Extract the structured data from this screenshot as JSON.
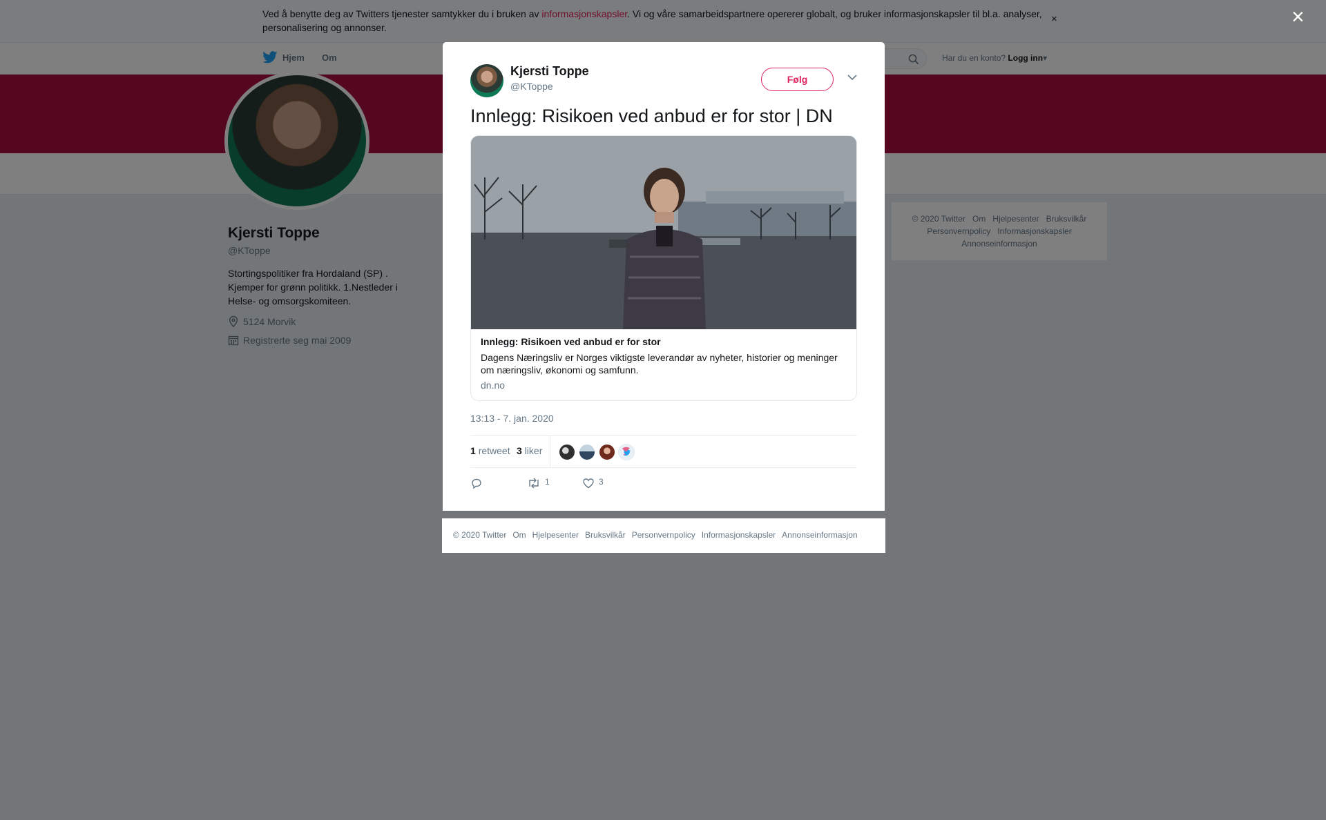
{
  "cookie": {
    "text_before": "Ved å benytte deg av Twitters tjenester samtykker du i bruken av ",
    "link": "informasjonskapsler",
    "text_after": ". Vi og våre samarbeidspartnere opererer globalt, og bruker informasjonskapsler til bl.a. analyser, personalisering og annonser.",
    "close": "×"
  },
  "nav": {
    "home": "Hjem",
    "about": "Om",
    "login_prompt": "Har du en konto?",
    "login": "Logg inn"
  },
  "profile": {
    "name": "Kjersti Toppe",
    "handle": "@KToppe",
    "bio": "Stortingspolitiker fra Hordaland (SP) . Kjemper for grønn politikk. 1.Nestleder i Helse- og omsorgskomiteen.",
    "location": "5124 Morvik",
    "joined": "Registrerte seg mai 2009"
  },
  "side_footer": [
    "© 2020 Twitter",
    "Om",
    "Hjelpesenter",
    "Bruksvilkår",
    "Personvernpolicy",
    "Informasjonskapsler",
    "Annonseinformasjon"
  ],
  "modal": {
    "close": "×",
    "name": "Kjersti Toppe",
    "handle": "@KToppe",
    "follow": "Følg",
    "tweet_text": "Innlegg: Risikoen ved anbud er for stor | DN",
    "card": {
      "title": "Innlegg: Risikoen ved anbud er for stor",
      "description": "Dagens Næringsliv er Norges viktigste leverandør av nyheter, historier og meninger om næringsliv, økonomi og samfunn.",
      "domain": "dn.no"
    },
    "timestamp": "13:13 - 7. jan. 2020",
    "retweets": "1",
    "retweets_label": "retweet",
    "likes": "3",
    "likes_label": "liker",
    "action_retweets": "1",
    "action_likes": "3"
  },
  "modal_footer": [
    "© 2020 Twitter",
    "Om",
    "Hjelpesenter",
    "Bruksvilkår",
    "Personvernpolicy",
    "Informasjonskapsler",
    "Annonseinformasjon"
  ],
  "colors": {
    "accent": "#e0245e",
    "banner": "#ad0e40",
    "twitter_blue": "#1da1f2",
    "muted": "#657786"
  }
}
